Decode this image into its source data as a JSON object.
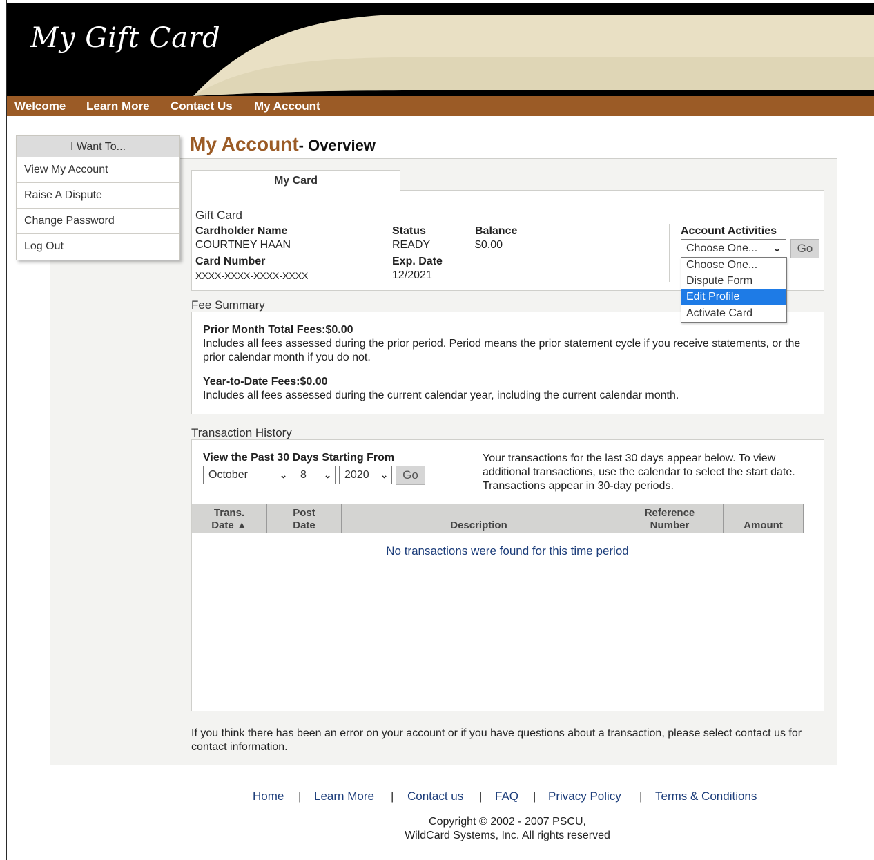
{
  "brand": {
    "logo_text": "My Gift Card"
  },
  "nav": {
    "items": [
      "Welcome",
      "Learn More",
      "Contact Us",
      "My Account"
    ]
  },
  "sidebar": {
    "title": "I Want To...",
    "items": [
      "View My Account",
      "Raise A Dispute",
      "Change Password",
      "Log Out"
    ]
  },
  "page": {
    "title": "My Account",
    "subtitle": "- Overview"
  },
  "card": {
    "tab_label": "My Card",
    "section_legend": "Gift Card",
    "cardholder_label": "Cardholder Name",
    "cardholder_value": "COURTNEY HAAN",
    "card_number_label": "Card Number",
    "card_number_value": "XXXX-XXXX-XXXX-XXXX",
    "status_label": "Status",
    "status_value": "READY",
    "exp_label": "Exp. Date",
    "exp_value": "12/2021",
    "balance_label": "Balance",
    "balance_value": "$0.00"
  },
  "account_activities": {
    "label": "Account Activities",
    "selected": "Choose One...",
    "go_label": "Go",
    "options": [
      "Choose One...",
      "Dispute Form",
      "Edit Profile",
      "Activate Card"
    ],
    "highlighted": "Edit Profile"
  },
  "fees": {
    "title": "Fee Summary",
    "prior_label": "Prior Month Total Fees:$0.00",
    "prior_desc": "Includes all fees assessed during the prior period. Period means the prior statement cycle if you receive statements, or the prior calendar month if you do not.",
    "ytd_label": "Year-to-Date Fees:$0.00",
    "ytd_desc": "Includes all fees assessed during the current calendar year, including the current calendar month."
  },
  "transactions": {
    "title": "Transaction History",
    "range_label": "View the Past 30 Days Starting From",
    "month": "October",
    "day": "8",
    "year": "2020",
    "go_label": "Go",
    "info": "Your transactions for the last 30 days appear below. To view additional transactions, use the calendar to select the start date. Transactions appear in 30-day periods.",
    "columns": [
      {
        "line1": "Trans.",
        "line2": "Date ▲"
      },
      {
        "line1": "Post",
        "line2": "Date"
      },
      {
        "line1": "",
        "line2": "Description"
      },
      {
        "line1": "Reference",
        "line2": "Number"
      },
      {
        "line1": "",
        "line2": "Amount"
      }
    ],
    "empty_message": "No transactions were found for this time period"
  },
  "bottom_note": "If you think there has been an error on your account or if you have questions about a transaction, please select contact us for contact information.",
  "footer": {
    "links": [
      "Home",
      "Learn More",
      "Contact us",
      "FAQ",
      "Privacy Policy",
      "Terms & Conditions"
    ],
    "separator": "|",
    "copyright_line1": "Copyright © 2002 - 2007 PSCU,",
    "copyright_line2": "WildCard Systems, Inc. All rights reserved"
  }
}
